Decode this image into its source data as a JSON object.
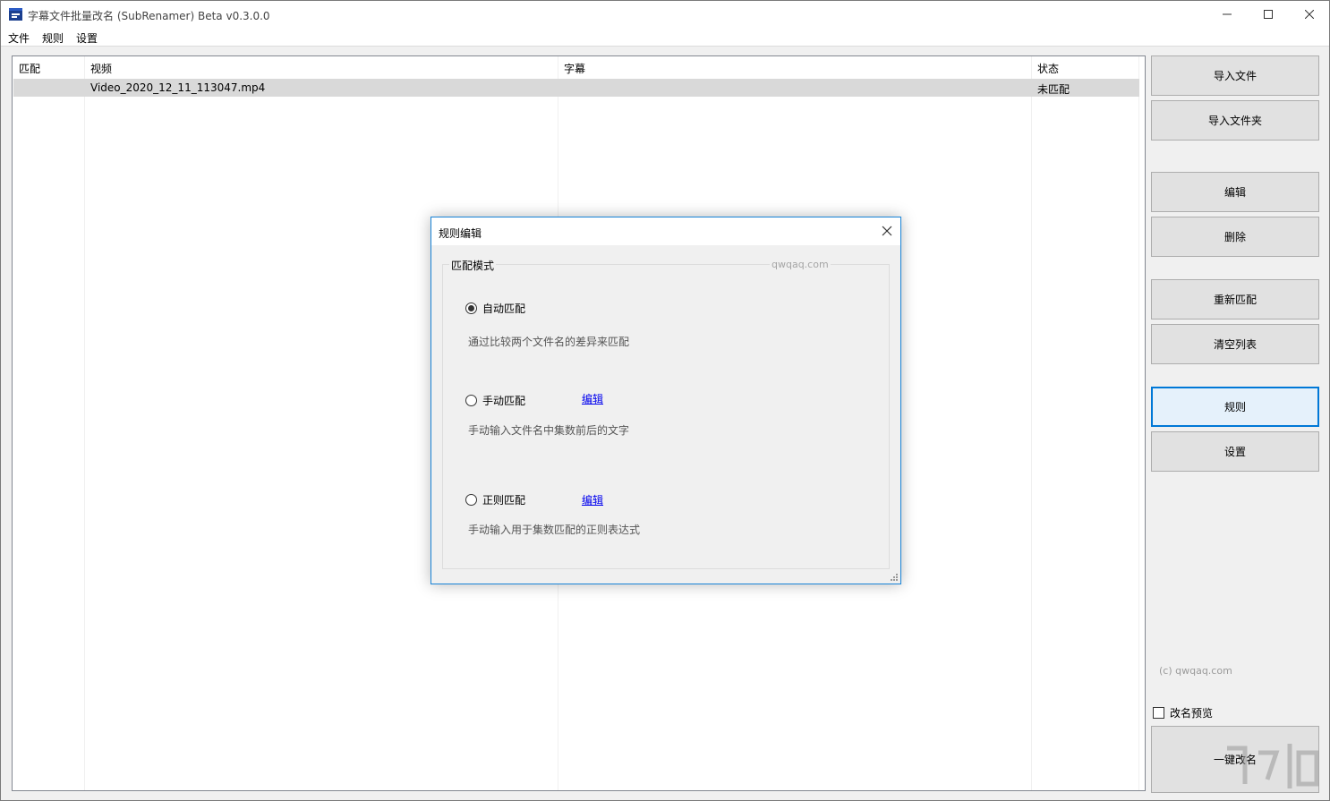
{
  "window": {
    "title": "字幕文件批量改名 (SubRenamer) Beta v0.3.0.0"
  },
  "menu": {
    "items": [
      "文件",
      "规则",
      "设置"
    ]
  },
  "list": {
    "columns": [
      "匹配",
      "视频",
      "字幕",
      "状态"
    ],
    "rows": [
      {
        "match": "",
        "video": "Video_2020_12_11_113047.mp4",
        "subtitle": "",
        "status": "未匹配"
      }
    ]
  },
  "buttons": {
    "import_file": "导入文件",
    "import_folder": "导入文件夹",
    "edit": "编辑",
    "delete": "删除",
    "rematch": "重新匹配",
    "clear_list": "清空列表",
    "rules": "规则",
    "settings": "设置",
    "rename": "一键改名"
  },
  "footer": {
    "copyright": "(c) qwqaq.com",
    "preview_label": "改名预览",
    "preview_checked": false
  },
  "dialog": {
    "title": "规则编辑",
    "group_label": "匹配模式",
    "watermark": "qwqaq.com",
    "options": [
      {
        "label": "自动匹配",
        "description": "通过比较两个文件名的差异来匹配",
        "selected": true,
        "link": ""
      },
      {
        "label": "手动匹配",
        "description": "手动输入文件名中集数前后的文字",
        "selected": false,
        "link": "编辑"
      },
      {
        "label": "正则匹配",
        "description": "手动输入用于集数匹配的正则表达式",
        "selected": false,
        "link": "编辑"
      }
    ]
  },
  "colors": {
    "accent": "#0078d7",
    "selected_row": "#d9d9d9",
    "link": "#0000ee"
  }
}
